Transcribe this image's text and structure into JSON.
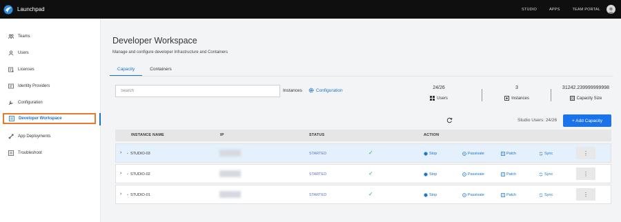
{
  "app": {
    "title": "Launchpad"
  },
  "topnav": [
    "STUDIO",
    "APPS",
    "TEAM PORTAL"
  ],
  "sidebar": {
    "items": [
      {
        "label": "Teams",
        "icon": "teams-icon"
      },
      {
        "label": "Users",
        "icon": "users-icon"
      },
      {
        "label": "Licenses",
        "icon": "licenses-icon"
      },
      {
        "label": "Identity Providers",
        "icon": "id-card-icon"
      },
      {
        "label": "Configuration",
        "icon": "wrench-icon"
      },
      {
        "label": "Developer Workspace",
        "icon": "workspace-icon",
        "active": true
      },
      {
        "label": "App Deployments",
        "icon": "rocket-icon"
      },
      {
        "label": "Troubleshoot",
        "icon": "troubleshoot-icon"
      }
    ]
  },
  "page": {
    "title": "Developer Workspace",
    "subtitle": "Manage and configure developer Infrastructure and Containers"
  },
  "tabs": [
    {
      "label": "Capacity",
      "active": true
    },
    {
      "label": "Containers",
      "active": false
    }
  ],
  "search": {
    "placeholder": "Search"
  },
  "instances_label": "Instances",
  "configuration_link": "Configuration",
  "stats": {
    "users": {
      "value": "24/26",
      "label": "Users"
    },
    "instances": {
      "value": "3",
      "label": "Instances"
    },
    "capacity": {
      "value": "31242.239999999998",
      "label": "Capacity Size"
    }
  },
  "studio_users": "Studio Users: 24/26",
  "add_button": "+ Add Capacity",
  "table": {
    "headers": {
      "name": "INSTANCE NAME",
      "ip": "IP",
      "status": "STATUS",
      "action": "ACTION"
    },
    "rows": [
      {
        "name": "STUDIO-03",
        "status": "STARTED",
        "highlighted": true
      },
      {
        "name": "STUDIO-02",
        "status": "STARTED",
        "highlighted": false
      },
      {
        "name": "STUDIO-01",
        "status": "STARTED",
        "highlighted": false
      }
    ],
    "actions": {
      "stop": "Stop",
      "passivate": "Passivate",
      "patch": "Patch",
      "sync": "Sync",
      "more": "⋮"
    }
  },
  "colors": {
    "accent": "#1a73c9",
    "button": "#1a73e8",
    "active_outline": "#e6792b",
    "topbar": "#0f0f10",
    "check": "#27ae60"
  }
}
